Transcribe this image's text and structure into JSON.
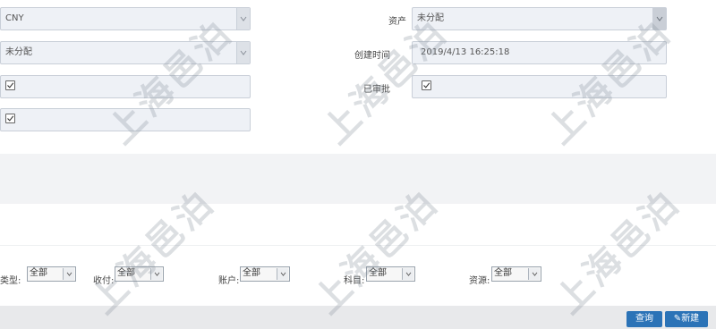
{
  "form": {
    "currency_value": "CNY",
    "asset_label": "资产",
    "asset_value": "未分配",
    "status_value": "未分配",
    "created_label": "创建时间",
    "created_value": "2019/4/13 16:25:18",
    "approved_label": "已审批"
  },
  "filters": {
    "type_label": "类型:",
    "type_value": "全部",
    "payment_label": "收付:",
    "payment_value": "全部",
    "account_label": "账户:",
    "account_value": "全部",
    "subject_label": "科目:",
    "subject_value": "全部",
    "resource_label": "资源:",
    "resource_value": "全部"
  },
  "actions": {
    "query_label": "查询",
    "new_label": "新建"
  },
  "watermark_text": "上海邑泊",
  "colors": {
    "field_bg": "#eef1f6",
    "band_bg": "#f2f3f5",
    "bottom_bar": "#e8e9eb",
    "button": "#2b73b7"
  }
}
